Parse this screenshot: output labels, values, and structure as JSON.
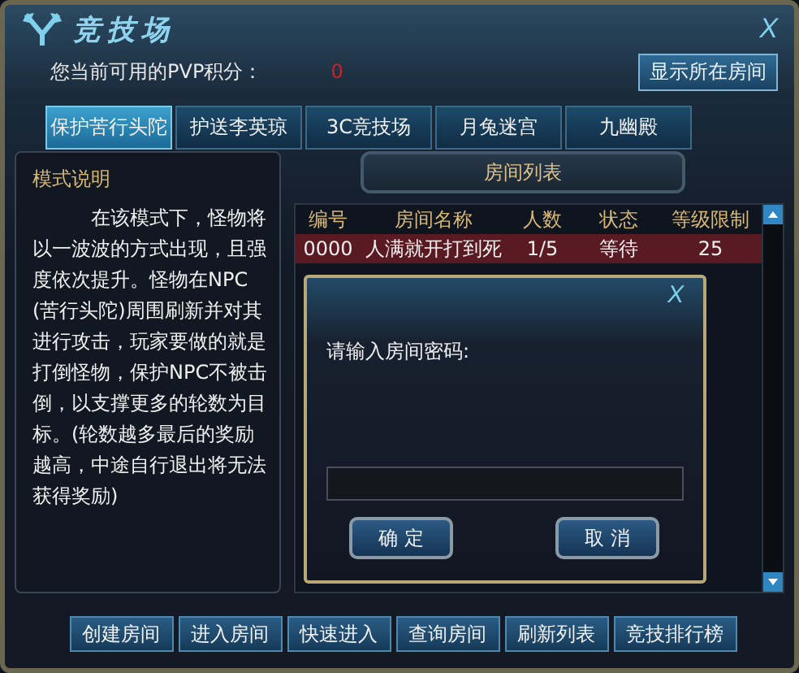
{
  "window": {
    "title": "竞技场",
    "close": "X"
  },
  "points": {
    "label": "您当前可用的PVP积分：",
    "value": "0"
  },
  "show_room_button": "显示所在房间",
  "tabs": [
    {
      "label": "保护苦行头陀",
      "selected": true
    },
    {
      "label": "护送李英琼",
      "selected": false
    },
    {
      "label": "3C竞技场",
      "selected": false
    },
    {
      "label": "月兔迷宫",
      "selected": false
    },
    {
      "label": "九幽殿",
      "selected": false
    }
  ],
  "mode": {
    "title": "模式说明",
    "text": "在该模式下，怪物将以一波波的方式出现，且强度依次提升。怪物在NPC(苦行头陀)周围刷新并对其进行攻击，玩家要做的就是打倒怪物，保护NPC不被击倒，以支撑更多的轮数为目标。(轮数越多最后的奖励越高，中途自行退出将无法获得奖励)"
  },
  "room_list": {
    "title": "房间列表",
    "columns": [
      "编号",
      "房间名称",
      "人数",
      "状态",
      "等级限制"
    ],
    "rows": [
      {
        "cells": [
          "0000",
          "人满就开打到死",
          "1/5",
          "等待",
          "25"
        ],
        "selected": true
      }
    ]
  },
  "dialog": {
    "close": "X",
    "prompt": "请输入房间密码:",
    "buttons": [
      "确 定",
      "取 消"
    ]
  },
  "buttons": [
    "创建房间",
    "进入房间",
    "快速进入",
    "查询房间",
    "刷新列表",
    "竞技排行榜"
  ]
}
